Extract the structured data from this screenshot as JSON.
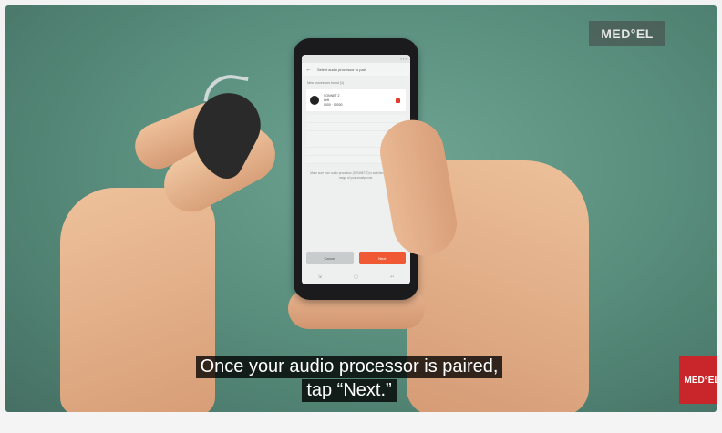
{
  "watermark": {
    "logo_text": "MED°EL"
  },
  "phone_screen": {
    "app_bar_title": "Select audio processor to pair",
    "section_label": "New processors found (1)",
    "processor": {
      "name": "SONNET 2",
      "detail_1": "Left",
      "detail_2": "0000 · 00000"
    },
    "info_text": "Make sure your audio processor (SONNET 2) is switched on and within range of your smartphone.",
    "cancel_label": "Cancel",
    "next_label": "Next",
    "accent_color": "#ef5a34"
  },
  "caption": {
    "line1": "Once your audio processor is paired,",
    "line2": "tap “Next.”"
  }
}
